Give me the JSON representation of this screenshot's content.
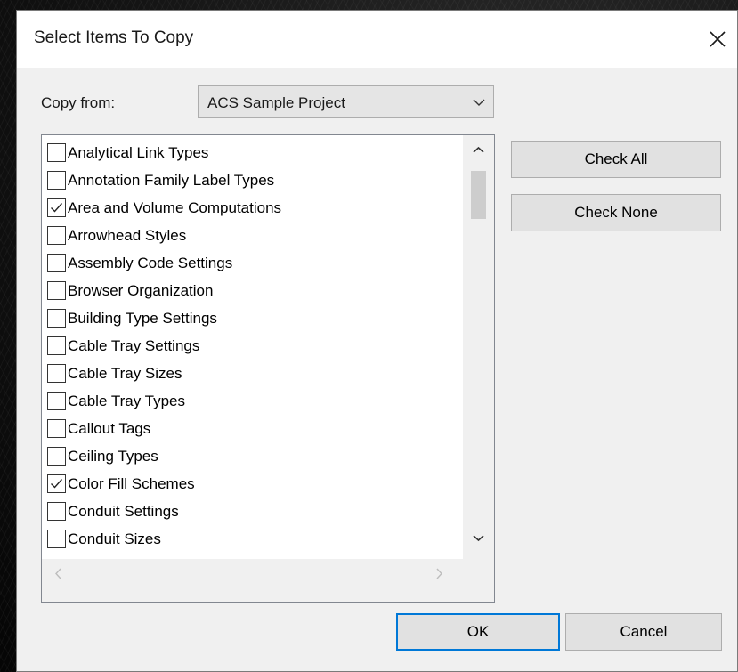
{
  "dialog": {
    "title": "Select Items To Copy",
    "copy_from_label": "Copy from:",
    "copy_from_value": "ACS Sample Project",
    "items": [
      {
        "label": "Analytical Link Types",
        "checked": false
      },
      {
        "label": "Annotation Family Label Types",
        "checked": false
      },
      {
        "label": "Area and Volume Computations",
        "checked": true
      },
      {
        "label": "Arrowhead Styles",
        "checked": false
      },
      {
        "label": "Assembly Code Settings",
        "checked": false
      },
      {
        "label": "Browser Organization",
        "checked": false
      },
      {
        "label": "Building Type Settings",
        "checked": false
      },
      {
        "label": "Cable Tray Settings",
        "checked": false
      },
      {
        "label": "Cable Tray Sizes",
        "checked": false
      },
      {
        "label": "Cable Tray Types",
        "checked": false
      },
      {
        "label": "Callout Tags",
        "checked": false
      },
      {
        "label": "Ceiling Types",
        "checked": false
      },
      {
        "label": "Color Fill Schemes",
        "checked": true
      },
      {
        "label": "Conduit Settings",
        "checked": false
      },
      {
        "label": "Conduit Sizes",
        "checked": false
      }
    ],
    "buttons": {
      "check_all": "Check All",
      "check_none": "Check None",
      "ok": "OK",
      "cancel": "Cancel"
    }
  },
  "colors": {
    "dialog_bg": "#f0f0f0",
    "titlebar_bg": "#ffffff",
    "default_button_border": "#0078d7"
  }
}
